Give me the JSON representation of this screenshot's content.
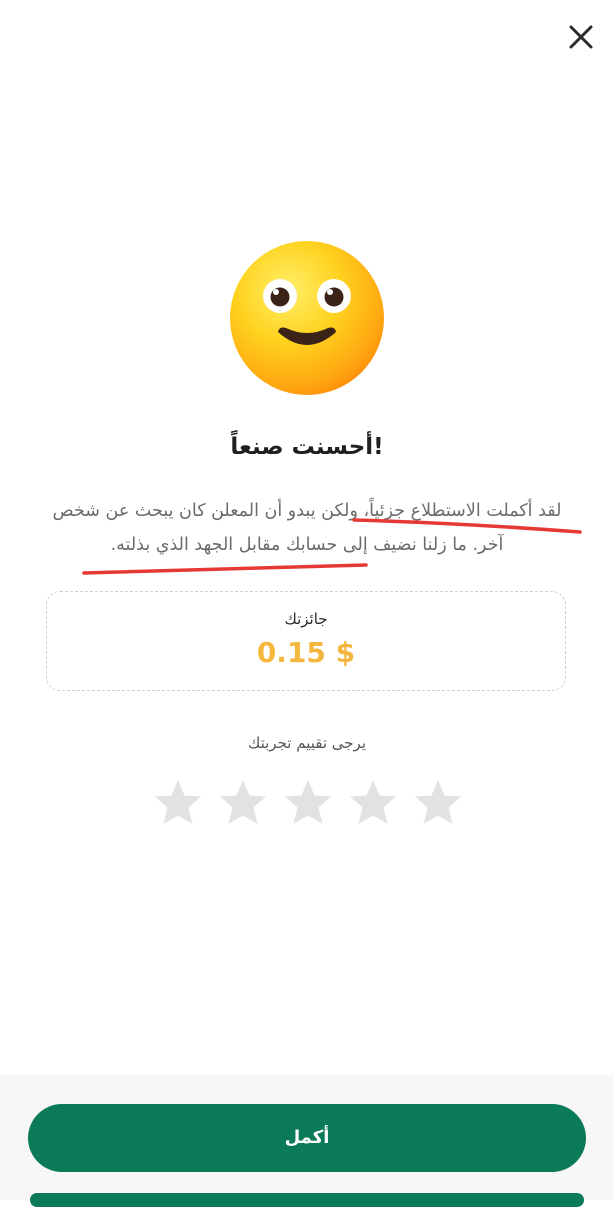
{
  "header": {
    "close_icon": "close-icon"
  },
  "emoji": {
    "icon": "smiling-face-icon"
  },
  "result": {
    "title": "!أحسنت صنعاً",
    "message": "لقد أكملت الاستطلاع جزئياً، ولكن يبدو أن المعلن كان يبحث عن شخص آخر. ما زلنا نضيف إلى حسابك مقابل الجهد الذي بذلته."
  },
  "reward": {
    "label": "جائزتك",
    "amount": "0.15 $"
  },
  "rating": {
    "prompt": "يرجى تقييم تجربتك",
    "max_stars": 5,
    "selected_stars": 0
  },
  "footer": {
    "continue_label": "أكمل"
  },
  "colors": {
    "primary": "#0a7a58",
    "reward": "#f4b63c",
    "star_inactive": "#e2e2e2",
    "annotation_underline": "#e53935"
  }
}
